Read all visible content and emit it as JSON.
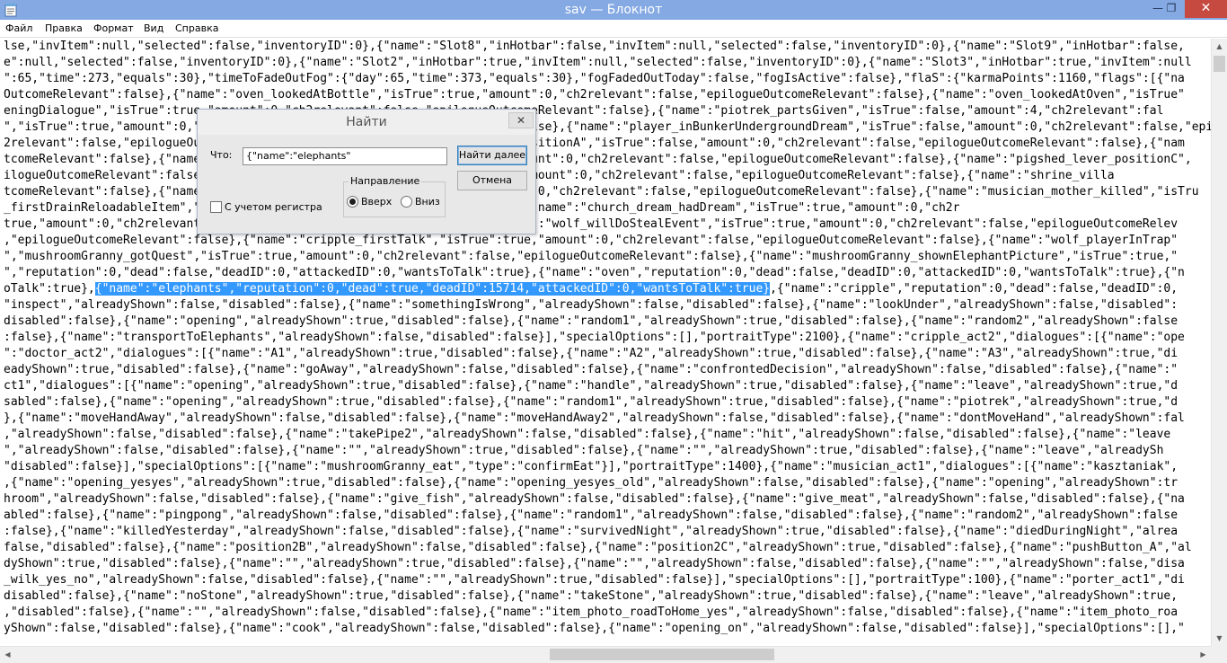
{
  "window": {
    "title": "sav — Блокнот",
    "close_glyph": "✕",
    "max_glyph": "❐",
    "min_glyph": "—"
  },
  "menu": {
    "items": [
      "Файл",
      "Правка",
      "Формат",
      "Вид",
      "Справка"
    ]
  },
  "editor": {
    "lines": [
      "lse,\"invItem\":null,\"selected\":false,\"inventoryID\":0},{\"name\":\"Slot8\",\"inHotbar\":false,\"invItem\":null,\"selected\":false,\"inventoryID\":0},{\"name\":\"Slot9\",\"inHotbar\":false,",
      "e\":null,\"selected\":false,\"inventoryID\":0},{\"name\":\"Slot2\",\"inHotbar\":true,\"invItem\":null,\"selected\":false,\"inventoryID\":0},{\"name\":\"Slot3\",\"inHotbar\":true,\"invItem\":null",
      "\":65,\"time\":273,\"equals\":30},\"timeToFadeOutFog\":{\"day\":65,\"time\":373,\"equals\":30},\"fogFadedOutToday\":false,\"fogIsActive\":false},\"flaS\":{\"karmaPoints\":1160,\"flags\":[{\"na",
      "OutcomeRelevant\":false},{\"name\":\"oven_lookedAtBottle\",\"isTrue\":true,\"amount\":0,\"ch2relevant\":false,\"epilogueOutcomeRelevant\":false},{\"name\":\"oven_lookedAtOven\",\"isTrue\"",
      "eningDialogue\",\"isTrue\":true,\"amount\":0,\"ch2relevant\":false,\"epilogueOutcomeRelevant\":false},{\"name\":\"piotrek_partsGiven\",\"isTrue\":false,\"amount\":4,\"ch2relevant\":fal",
      "\",\"isTrue\":true,\"amount\":0,\"ch2relevant\":false,\"epilogueOutcomeRelevant\":false},{\"name\":\"player_inBunkerUndergroundDream\",\"isTrue\":false,\"amount\":0,\"ch2relevant\":false,\"epiloguc",
      "2relevant\":false,\"epilogueOutcomeRelevant\":false},{\"name\":\"pigshed_lever_positionA\",\"isTrue\":false,\"amount\":0,\"ch2relevant\":false,\"epilogueOutcomeRelevant\":false},{\"nam",
      "tcomeRelevant\":false},{\"name\":\"pigshed_lever_positionB\",\"isTrue\":false,\"amount\":0,\"ch2relevant\":false,\"epilogueOutcomeRelevant\":false},{\"name\":\"pigshed_lever_positionC\",",
      "ilogueOutcomeRelevant\":false},{\"name\":\"pigshed_lever_used\",\"isTrue\":true,\"amount\":0,\"ch2relevant\":false,\"epilogueOutcomeRelevant\":false},{\"name\":\"shrine_villa",
      "tcomeRelevant\":false},{\"name\":\"house_drainedCellar\",\"isTrue\":false,\"amount\":0,\"ch2relevant\":false,\"epilogueOutcomeRelevant\":false},{\"name\":\"musician_mother_killed\",\"isTru",
      "_firstDrainReloadableItem\",\"isTrue\":false,\"amount\":0,\"ch2relevant\":false},{\"name\":\"church_dream_hadDream\",\"isTrue\":true,\"amount\":0,\"ch2r",
      "true,\"amount\":0,\"ch2relevant\":false,\"epilogueOutcomeRelevant\":false},{\"name\":\"wolf_willDoStealEvent\",\"isTrue\":true,\"amount\":0,\"ch2relevant\":false,\"epilogueOutcomeRelev",
      ",\"epilogueOutcomeRelevant\":false},{\"name\":\"cripple_firstTalk\",\"isTrue\":true,\"amount\":0,\"ch2relevant\":false,\"epilogueOutcomeRelevant\":false},{\"name\":\"wolf_playerInTrap\"",
      "\",\"mushroomGranny_gotQuest\",\"isTrue\":true,\"amount\":0,\"ch2relevant\":false,\"epilogueOutcomeRelevant\":false},{\"name\":\"mushroomGranny_shownElephantPicture\",\"isTrue\":true,\"",
      "\",\"reputation\":0,\"dead\":false,\"deadID\":0,\"attackedID\":0,\"wantsToTalk\":true},{\"name\":\"oven\",\"reputation\":0,\"dead\":false,\"deadID\":0,\"attackedID\":0,\"wantsToTalk\":true},{\"n",
      "oTalk\":true},",
      "\"inspect\",\"alreadyShown\":false,\"disabled\":false},{\"name\":\"somethingIsWrong\",\"alreadyShown\":false,\"disabled\":false},{\"name\":\"lookUnder\",\"alreadyShown\":false,\"disabled\":",
      "disabled\":false},{\"name\":\"opening\",\"alreadyShown\":true,\"disabled\":false},{\"name\":\"random1\",\"alreadyShown\":true,\"disabled\":false},{\"name\":\"random2\",\"alreadyShown\":false",
      ":false},{\"name\":\"transportToElephants\",\"alreadyShown\":false,\"disabled\":false}],\"specialOptions\":[],\"portraitType\":2100},{\"name\":\"cripple_act2\",\"dialogues\":[{\"name\":\"ope",
      "\":\"doctor_act2\",\"dialogues\":[{\"name\":\"A1\",\"alreadyShown\":true,\"disabled\":false},{\"name\":\"A2\",\"alreadyShown\":true,\"disabled\":false},{\"name\":\"A3\",\"alreadyShown\":true,\"di",
      "eadyShown\":true,\"disabled\":false},{\"name\":\"goAway\",\"alreadyShown\":false,\"disabled\":false},{\"name\":\"confrontedDecision\",\"alreadyShown\":false,\"disabled\":false},{\"name\":\"",
      "ct1\",\"dialogues\":[{\"name\":\"opening\",\"alreadyShown\":true,\"disabled\":false},{\"name\":\"handle\",\"alreadyShown\":true,\"disabled\":false},{\"name\":\"leave\",\"alreadyShown\":true,\"d",
      "sabled\":false},{\"name\":\"opening\",\"alreadyShown\":true,\"disabled\":false},{\"name\":\"random1\",\"alreadyShown\":true,\"disabled\":false},{\"name\":\"piotrek\",\"alreadyShown\":true,\"d",
      "},{\"name\":\"moveHandAway\",\"alreadyShown\":false,\"disabled\":false},{\"name\":\"moveHandAway2\",\"alreadyShown\":false,\"disabled\":false},{\"name\":\"dontMoveHand\",\"alreadyShown\":fal",
      ",\"alreadyShown\":false,\"disabled\":false},{\"name\":\"takePipe2\",\"alreadyShown\":false,\"disabled\":false},{\"name\":\"hit\",\"alreadyShown\":false,\"disabled\":false},{\"name\":\"leave",
      "\",\"alreadyShown\":false,\"disabled\":false},{\"name\":\"\",\"alreadyShown\":true,\"disabled\":false},{\"name\":\"\",\"alreadyShown\":true,\"disabled\":false},{\"name\":\"leave\",\"alreadySh",
      "\"disabled\":false}],\"specialOptions\":[{\"name\":\"mushroomGranny_eat\",\"type\":\"confirmEat\"}],\"portraitType\":1400},{\"name\":\"musician_act1\",\"dialogues\":[{\"name\":\"kasztaniak\",",
      ",{\"name\":\"opening_yesyes\",\"alreadyShown\":true,\"disabled\":false},{\"name\":\"opening_yesyes_old\",\"alreadyShown\":false,\"disabled\":false},{\"name\":\"opening\",\"alreadyShown\":tr",
      "hroom\",\"alreadyShown\":false,\"disabled\":false},{\"name\":\"give_fish\",\"alreadyShown\":false,\"disabled\":false},{\"name\":\"give_meat\",\"alreadyShown\":false,\"disabled\":false},{\"na",
      "abled\":false},{\"name\":\"pingpong\",\"alreadyShown\":false,\"disabled\":false},{\"name\":\"random1\",\"alreadyShown\":false,\"disabled\":false},{\"name\":\"random2\",\"alreadyShown\":false",
      ":false},{\"name\":\"killedYesterday\",\"alreadyShown\":false,\"disabled\":false},{\"name\":\"survivedNight\",\"alreadyShown\":true,\"disabled\":false},{\"name\":\"diedDuringNight\",\"alrea",
      "false,\"disabled\":false},{\"name\":\"position2B\",\"alreadyShown\":false,\"disabled\":false},{\"name\":\"position2C\",\"alreadyShown\":true,\"disabled\":false},{\"name\":\"pushButton_A\",\"al",
      "dyShown\":true,\"disabled\":false},{\"name\":\"\",\"alreadyShown\":true,\"disabled\":false},{\"name\":\"\",\"alreadyShown\":false,\"disabled\":false},{\"name\":\"\",\"alreadyShown\":false,\"disa",
      "_wilk_yes_no\",\"alreadyShown\":false,\"disabled\":false},{\"name\":\"\",\"alreadyShown\":true,\"disabled\":false}],\"specialOptions\":[],\"portraitType\":100},{\"name\":\"porter_act1\",\"di",
      "disabled\":false},{\"name\":\"noStone\",\"alreadyShown\":true,\"disabled\":false},{\"name\":\"takeStone\",\"alreadyShown\":true,\"disabled\":false},{\"name\":\"leave\",\"alreadyShown\":true,",
      ",\"disabled\":false},{\"name\":\"\",\"alreadyShown\":false,\"disabled\":false},{\"name\":\"item_photo_roadToHome_yes\",\"alreadyShown\":false,\"disabled\":false},{\"name\":\"item_photo_roa",
      "yShown\":false,\"disabled\":false},{\"name\":\"cook\",\"alreadyShown\":false,\"disabled\":false},{\"name\":\"opening_on\",\"alreadyShown\":false,\"disabled\":false}],\"specialOptions\":[],\""
    ],
    "selected_text": "{\"name\":\"elephants\",\"reputation\":0,\"dead\":true,\"deadID\":15714,\"attackedID\":0,\"wantsToTalk\":true}",
    "after_selection": ",{\"name\":\"cripple\",\"reputation\":0,\"dead\":false,\"deadID\":0,",
    "selection_color": "#3399ff"
  },
  "find_dialog": {
    "title": "Найти",
    "close_glyph": "✕",
    "find_what_label": "Что:",
    "find_what_value": "{\"name\":\"elephants\"",
    "find_next_button": "Найти далее",
    "cancel_button": "Отмена",
    "direction_label": "Направление",
    "direction_up_label": "Вверх",
    "direction_down_label": "Вниз",
    "direction_selected": "up",
    "match_case_label": "С учетом регистра",
    "match_case_checked": false
  },
  "scrollbars": {
    "up_glyph": "▲",
    "down_glyph": "▼",
    "left_glyph": "◀",
    "right_glyph": "▶"
  },
  "colors": {
    "titlebar": "#85a9e3",
    "close_button": "#c74a41",
    "selection": "#3399ff"
  }
}
